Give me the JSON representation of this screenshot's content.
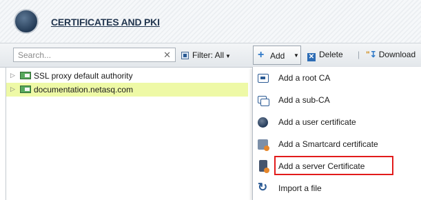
{
  "header": {
    "title": "CERTIFICATES AND PKI",
    "icon": "database-icon"
  },
  "toolbar": {
    "search_placeholder": "Search...",
    "clear_symbol": "✕",
    "filter_label": "Filter: All",
    "add_label": "Add",
    "delete_label": "Delete",
    "separator": "|",
    "download_label": "Download"
  },
  "tree": {
    "items": [
      {
        "label": "SSL proxy default authority",
        "selected": false,
        "icon": "certificate-authority-icon"
      },
      {
        "label": "documentation.netasq.com",
        "selected": true,
        "icon": "certificate-authority-icon"
      }
    ]
  },
  "add_menu": {
    "items": [
      {
        "label": "Add a root CA",
        "icon": "root-ca-icon"
      },
      {
        "label": "Add a sub-CA",
        "icon": "sub-ca-icon"
      },
      {
        "label": "Add a user certificate",
        "icon": "user-certificate-icon"
      },
      {
        "label": "Add a Smartcard certificate",
        "icon": "smartcard-certificate-icon"
      },
      {
        "label": "Add a server Certificate",
        "icon": "server-certificate-icon",
        "highlighted": true
      },
      {
        "label": "Import a file",
        "icon": "import-file-icon"
      }
    ],
    "highlight_color": "#e21b1b"
  },
  "colors": {
    "selected_row": "#eef9a6",
    "accent": "#2f79c8",
    "header_text": "#22364f"
  }
}
